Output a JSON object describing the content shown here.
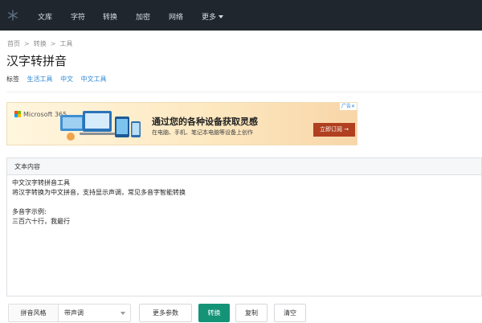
{
  "nav": {
    "items": [
      "文库",
      "字符",
      "转换",
      "加密",
      "网络",
      "更多"
    ]
  },
  "breadcrumb": [
    "首页",
    "转换",
    "工具"
  ],
  "breadcrumb_sep": ">",
  "page_title": "汉字转拼音",
  "tags": {
    "label": "标签",
    "items": [
      "生活工具",
      "中文",
      "中文工具"
    ]
  },
  "ad": {
    "brand": "Microsoft 365",
    "headline": "通过您的各种设备获取灵感",
    "sub": "在电脑、手机、笔记本电脑等设备上创作",
    "cta": "立即订阅 →",
    "flag": "广告✕"
  },
  "editor": {
    "header": "文本内容",
    "content": "中文汉字转拼音工具\n将汉字转换为中文拼音，支持显示声调，常见多音字智能转换\n\n多音字示例:\n三百六十行，我最行"
  },
  "controls": {
    "style_label": "拼音风格",
    "style_value": "带声调",
    "more_params": "更多参数",
    "convert": "转换",
    "copy": "复制",
    "clear": "清空"
  },
  "colors": {
    "navbar": "#20262d",
    "accent_link": "#2d8ad6",
    "convert_button": "#149377",
    "ad_cta": "#b0401f"
  },
  "icons": {
    "logo": "snowflake-logo-icon",
    "more_caret": "caret-down-icon",
    "select_caret": "chevron-down-icon"
  }
}
